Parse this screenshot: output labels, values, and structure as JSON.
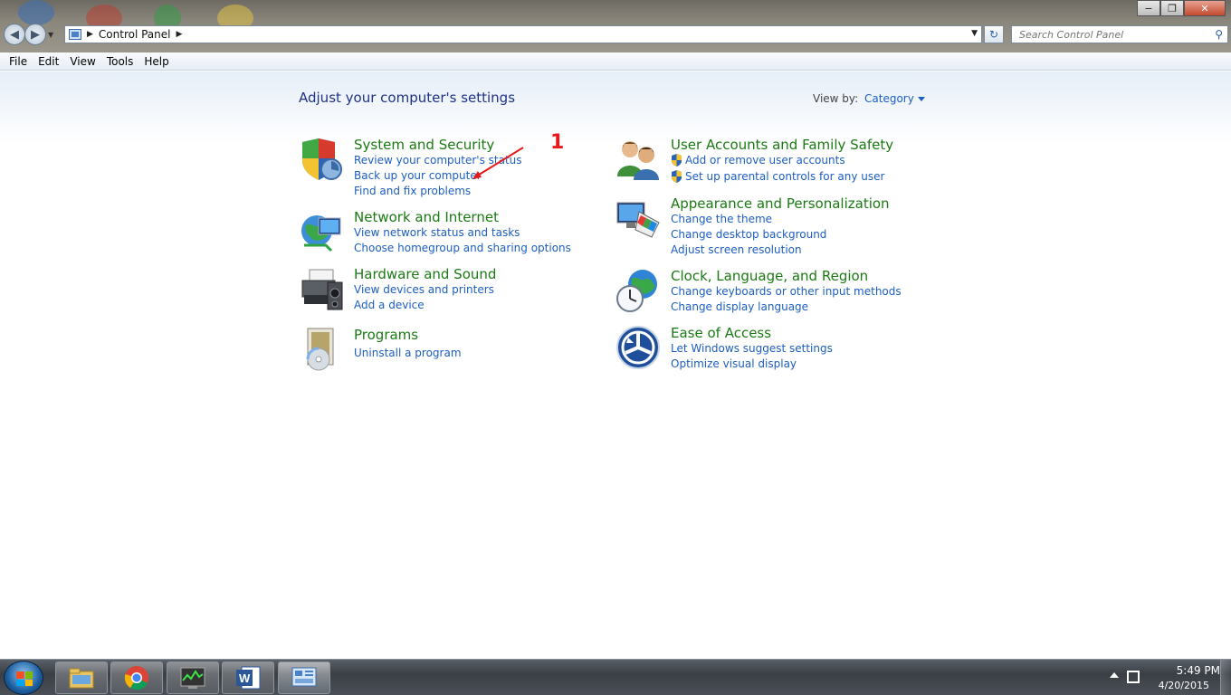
{
  "window": {
    "minimize_label": "−",
    "restore_label": "❐",
    "close_label": "✕"
  },
  "address_bar": {
    "breadcrumb": [
      "Control Panel"
    ],
    "search_placeholder": "Search Control Panel"
  },
  "menu": [
    "File",
    "Edit",
    "View",
    "Tools",
    "Help"
  ],
  "page": {
    "title": "Adjust your computer's settings",
    "view_by_label": "View by:",
    "view_by_value": "Category"
  },
  "categories": [
    {
      "heading": "System and Security",
      "icon": "shield-icon",
      "links": [
        "Review your computer's status",
        "Back up your computer",
        "Find and fix problems"
      ]
    },
    {
      "heading": "Network and Internet",
      "icon": "network-globe-icon",
      "links": [
        "View network status and tasks",
        "Choose homegroup and sharing options"
      ]
    },
    {
      "heading": "Hardware and Sound",
      "icon": "printer-speaker-icon",
      "links": [
        "View devices and printers",
        "Add a device"
      ]
    },
    {
      "heading": "Programs",
      "icon": "programs-disc-icon",
      "links": [
        "Uninstall a program"
      ]
    },
    {
      "heading": "User Accounts and Family Safety",
      "icon": "users-icon",
      "links": [
        "Add or remove user accounts",
        "Set up parental controls for any user"
      ]
    },
    {
      "heading": "Appearance and Personalization",
      "icon": "monitor-palette-icon",
      "links": [
        "Change the theme",
        "Change desktop background",
        "Adjust screen resolution"
      ]
    },
    {
      "heading": "Clock, Language, and Region",
      "icon": "clock-globe-icon",
      "links": [
        "Change keyboards or other input methods",
        "Change display language"
      ]
    },
    {
      "heading": "Ease of Access",
      "icon": "ease-of-access-icon",
      "links": [
        "Let Windows suggest settings",
        "Optimize visual display"
      ]
    }
  ],
  "annotation": {
    "number": "1"
  },
  "taskbar": {
    "apps": [
      "file-explorer-icon",
      "chrome-icon",
      "task-manager-icon",
      "word-icon",
      "control-panel-icon"
    ],
    "time": "5:49 PM",
    "date": "4/20/2015"
  },
  "colors": {
    "heading_green": "#1a7a12",
    "link_blue": "#1c5ec2",
    "title_navy": "#1e3287",
    "annotation_red": "#e61a1a"
  }
}
